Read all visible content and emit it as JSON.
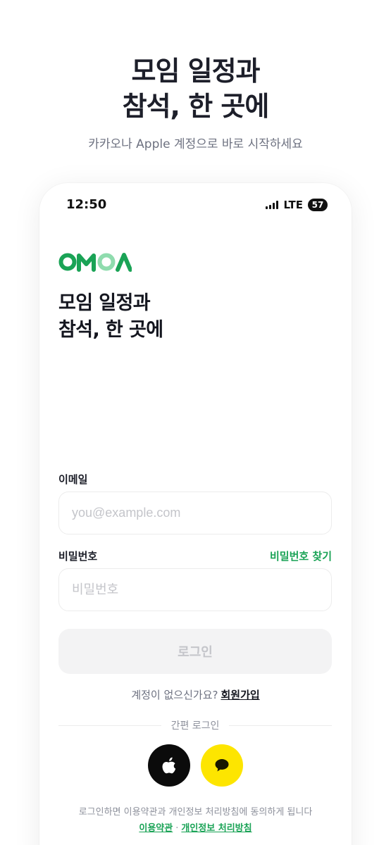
{
  "hero": {
    "title_line1": "모임 일정과",
    "title_line2": "참석, 한 곳에",
    "subtitle": "카카오나 Apple 계정으로 바로 시작하세요"
  },
  "status_bar": {
    "time": "12:50",
    "network": "LTE",
    "battery": "57",
    "signal_icon": "signal-bars-icon"
  },
  "app": {
    "logo_text": "OMOA",
    "title_line1": "모임 일정과",
    "title_line2": "참석, 한 곳에"
  },
  "form": {
    "email_label": "이메일",
    "email_placeholder": "you@example.com",
    "email_value": "",
    "password_label": "비밀번호",
    "password_placeholder": "비밀번호",
    "password_value": "",
    "forgot_password": "비밀번호 찾기",
    "login_button": "로그인"
  },
  "signup": {
    "prompt": "계정이 없으신가요?",
    "link": "회원가입"
  },
  "social": {
    "divider_text": "간편 로그인",
    "apple_icon": "apple-icon",
    "kakao_icon": "speech-bubble-icon"
  },
  "terms": {
    "notice": "로그인하면 이용약관과 개인정보 처리방침에 동의하게 됩니다",
    "terms_link": "이용약관",
    "separator": "·",
    "privacy_link": "개인정보 처리방침"
  },
  "colors": {
    "brand_green": "#1aa356",
    "logo_light_green": "#8fdcae",
    "kakao_yellow": "#fde500",
    "apple_black": "#0b0b0b",
    "disabled_button": "#f3f3f4"
  }
}
